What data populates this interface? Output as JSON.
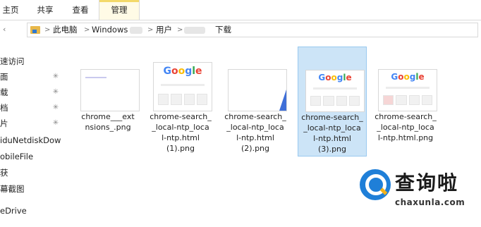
{
  "ribbon": {
    "tabs": [
      "主页",
      "共享",
      "查看",
      "管理"
    ]
  },
  "address": {
    "icon": "folder-icon",
    "separators": [
      ">",
      ">",
      ">",
      ">"
    ],
    "crumbs": [
      "此电脑",
      "Windows",
      "用户",
      "下载"
    ],
    "nav_icon": "chevron-left-icon"
  },
  "sidebar": {
    "items": [
      {
        "label": "速访问",
        "pinned": false
      },
      {
        "label": "面",
        "pinned": true
      },
      {
        "label": "载",
        "pinned": true
      },
      {
        "label": "档",
        "pinned": true
      },
      {
        "label": "片",
        "pinned": true
      },
      {
        "label": "iduNetdiskDow",
        "pinned": false
      },
      {
        "label": "obileFile",
        "pinned": false
      },
      {
        "label": "获",
        "pinned": false
      },
      {
        "label": "幕截图",
        "pinned": false
      },
      {
        "label": "eDrive",
        "pinned": false
      }
    ],
    "pin_icon": "pin-icon"
  },
  "files": [
    {
      "name_lines": [
        "chrome___ext",
        "nsions_.png"
      ],
      "selected": false,
      "thumb": "extensions"
    },
    {
      "name_lines": [
        "chrome-search_",
        "_local-ntp_loca",
        "l-ntp.html",
        "(1).png"
      ],
      "selected": false,
      "thumb": "google"
    },
    {
      "name_lines": [
        "chrome-search_",
        "_local-ntp_loca",
        "l-ntp.html",
        "(2).png"
      ],
      "selected": false,
      "thumb": "blank"
    },
    {
      "name_lines": [
        "chrome-search_",
        "_local-ntp_loca",
        "l-ntp.html",
        "(3).png"
      ],
      "selected": true,
      "thumb": "google"
    },
    {
      "name_lines": [
        "chrome-search_",
        "_local-ntp_loca",
        "l-ntp.html.png"
      ],
      "selected": false,
      "thumb": "google-red"
    }
  ],
  "thumb_text": {
    "google": [
      "G",
      "o",
      "o",
      "g",
      "l",
      "e"
    ]
  },
  "watermark": {
    "cn": "查询啦",
    "en": "chaxunla.com",
    "icon": "search-logo-icon"
  },
  "colors": {
    "selected_bg": "#cce4f7",
    "selected_border": "#99c9ef",
    "manage_tab_accent": "#f3d96a",
    "logo_blue": "#1f7fd8"
  }
}
